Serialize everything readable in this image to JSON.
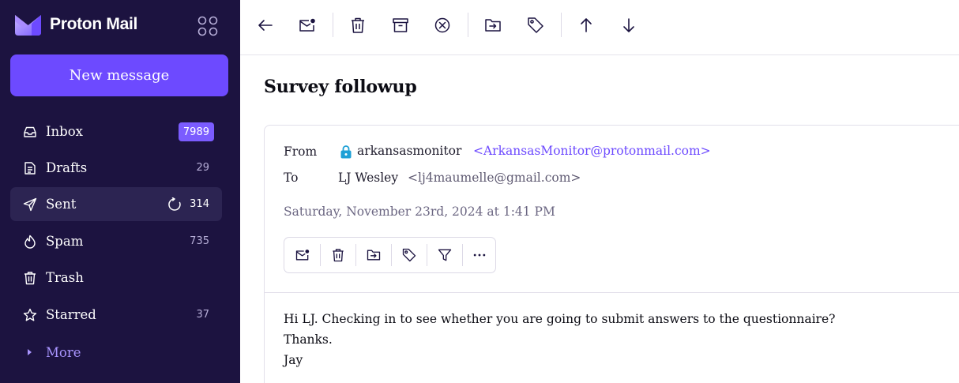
{
  "app": {
    "brand_name": "Proton Mail",
    "brand_color": "#6d4aff",
    "sidebar_bg": "#1c1340"
  },
  "sidebar": {
    "new_message_label": "New message",
    "items": [
      {
        "label": "Inbox",
        "count": "7989",
        "icon": "inbox-icon",
        "badge": true
      },
      {
        "label": "Drafts",
        "count": "29",
        "icon": "drafts-icon"
      },
      {
        "label": "Sent",
        "count": "314",
        "icon": "sent-icon",
        "active": true,
        "refresh_icon": "refresh-icon"
      },
      {
        "label": "Spam",
        "count": "735",
        "icon": "spam-icon"
      },
      {
        "label": "Trash",
        "count": "",
        "icon": "trash-icon"
      },
      {
        "label": "Starred",
        "count": "37",
        "icon": "star-icon"
      }
    ],
    "more_label": "More"
  },
  "toolbar": {
    "buttons": [
      "back-arrow-icon",
      "mark-unread-icon",
      "trash-icon",
      "archive-icon",
      "spam-icon",
      "move-to-folder-icon",
      "label-icon",
      "previous-arrow-icon",
      "next-arrow-icon"
    ]
  },
  "message": {
    "subject": "Survey followup",
    "from_label": "From",
    "from_name": "arkansasmonitor",
    "from_email": "<ArkansasMonitor@protonmail.com>",
    "to_label": "To",
    "to_name": "LJ Wesley",
    "to_email": "<lj4maumelle@gmail.com>",
    "date": "Saturday, November 23rd, 2024 at 1:41 PM",
    "actions": [
      "mark-unread-icon",
      "trash-icon",
      "move-to-folder-icon",
      "label-icon",
      "filter-icon",
      "more-options-icon"
    ],
    "body": [
      "Hi LJ. Checking in to see whether you are going to submit answers to the questionnaire?",
      "Thanks.",
      "Jay"
    ]
  }
}
